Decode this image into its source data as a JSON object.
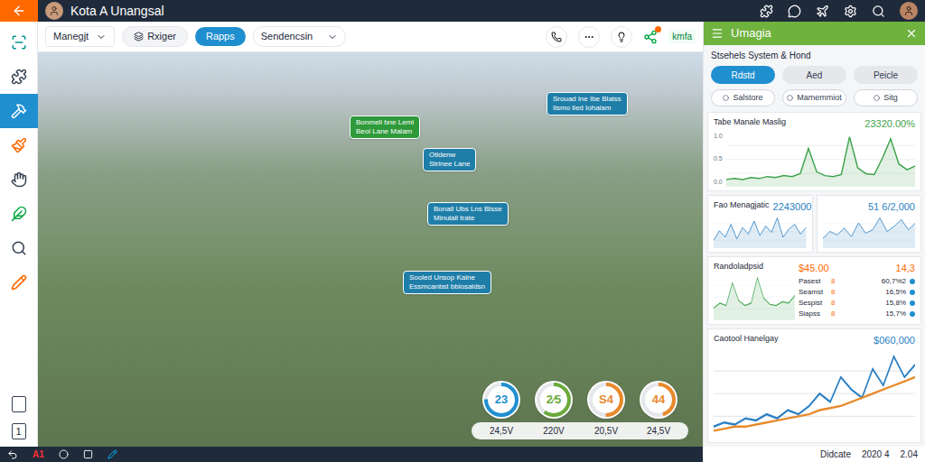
{
  "window": {
    "title": "Kota A Unangsal"
  },
  "sidebar": {
    "items": [
      {
        "selected": false
      },
      {
        "selected": false
      },
      {
        "selected": true
      },
      {
        "selected": false
      },
      {
        "selected": false
      },
      {
        "selected": false
      },
      {
        "selected": false
      },
      {
        "selected": false
      }
    ],
    "bottom_items": [
      {
        "label": ""
      },
      {
        "label": "1"
      }
    ]
  },
  "toolbar": {
    "dropdown": "Manegjt",
    "filters": [
      {
        "label": "Rxiger",
        "selected": false
      },
      {
        "label": "Rapps",
        "selected": true
      }
    ],
    "sort": "Sendencsin",
    "badge": "kmfa"
  },
  "map": {
    "callouts": [
      {
        "lines": [
          "Srouad lne Ibe Blaiss",
          "Ilsmo lled Iohalam"
        ],
        "color": "#1f7ea8"
      },
      {
        "lines": [
          "Bonmeli bne Lemi",
          "Beol Lane Malam"
        ],
        "color": "#2e9a3a"
      },
      {
        "lines": [
          "Otidenw",
          "Strinee Lane"
        ],
        "color": "#1f7ea8"
      },
      {
        "lines": [
          "Bonall Ubs Lns Blsse",
          "Minulall trate"
        ],
        "color": "#1f7ea8"
      },
      {
        "lines": [
          "Sooled Unsop Kalne",
          "Essmcanbst bbiosaldsn"
        ],
        "color": "#1f7ea8"
      }
    ],
    "gauges": [
      {
        "value": "23",
        "label": "24,5V",
        "level": 0.75,
        "color": "#1f8fd0"
      },
      {
        "value": "2⁄5",
        "label": "220V",
        "level": 0.6,
        "color": "#6aaa3a"
      },
      {
        "value": "S4",
        "label": "20,5V",
        "level": 0.5,
        "color": "#e8892a"
      },
      {
        "value": "44",
        "label": "24,5V",
        "level": 0.45,
        "color": "#e8892a"
      }
    ]
  },
  "panel": {
    "title": "Umagia",
    "subtitle": "Stsehels System & Hond",
    "tabs": [
      {
        "label": "Rdstd",
        "selected": true
      },
      {
        "label": "Aed",
        "selected": false
      },
      {
        "label": "Peicle",
        "selected": false
      }
    ],
    "filters": [
      "Salstore",
      "Mamemmiot",
      "Sitg"
    ],
    "card1": {
      "title": "Tabe Manale Maslig",
      "value": "23320.00%",
      "ticks": [
        "1.0",
        "0.5",
        "0.0"
      ],
      "series": [
        {
          "values": [
            8,
            9,
            8,
            10,
            9,
            11,
            10,
            12,
            11,
            14,
            40,
            16,
            12,
            11,
            13,
            52,
            20,
            14,
            13,
            30,
            50,
            24,
            18,
            22
          ],
          "color": "#3fa34d"
        }
      ]
    },
    "card2": [
      {
        "title": "Fao Menagjatic",
        "value": "2243000",
        "series": [
          {
            "values": [
              10,
              22,
              14,
              30,
              12,
              26,
              18,
              34,
              16,
              28,
              20,
              38,
              14,
              24,
              30,
              18,
              26
            ],
            "color": "#2b7fc4"
          }
        ]
      },
      {
        "title": "",
        "value": "51 6/2,000",
        "series": [
          {
            "values": [
              12,
              20,
              16,
              24,
              14,
              30,
              18,
              22,
              36,
              20,
              26,
              34,
              22,
              30
            ],
            "color": "#2b7fc4"
          }
        ]
      }
    ],
    "card3": {
      "title": "Randoladpsid",
      "value": "$45.00",
      "value2": "14,3",
      "rows": [
        {
          "name": "Pasest",
          "mark": "8",
          "value": "60,7%2"
        },
        {
          "name": "Seamst",
          "mark": "8",
          "value": "16,5%"
        },
        {
          "name": "Sespist",
          "mark": "8",
          "value": "15,8%"
        },
        {
          "name": "Siapss",
          "mark": "8",
          "value": "15,7%"
        }
      ],
      "series": [
        {
          "values": [
            10,
            14,
            12,
            30,
            16,
            12,
            14,
            34,
            18,
            13,
            12,
            15,
            14,
            20
          ],
          "color": "#3fa34d"
        }
      ]
    },
    "card4": {
      "title": "Caotool Hanelgay",
      "value": "$060,000",
      "series": [
        {
          "values": [
            6,
            8,
            7,
            10,
            9,
            12,
            10,
            14,
            12,
            16,
            22,
            18,
            30,
            24,
            20,
            34,
            26,
            40,
            30,
            36
          ],
          "color": "#2b7fc4"
        },
        {
          "values": [
            4,
            5,
            6,
            6,
            7,
            8,
            9,
            10,
            11,
            12,
            14,
            15,
            16,
            18,
            20,
            22,
            24,
            26,
            28,
            30
          ],
          "color": "#e8892a"
        }
      ]
    }
  },
  "status_bar": {
    "left": "A1",
    "text": "Didcate",
    "date": "2020 4",
    "time": "2.04"
  }
}
